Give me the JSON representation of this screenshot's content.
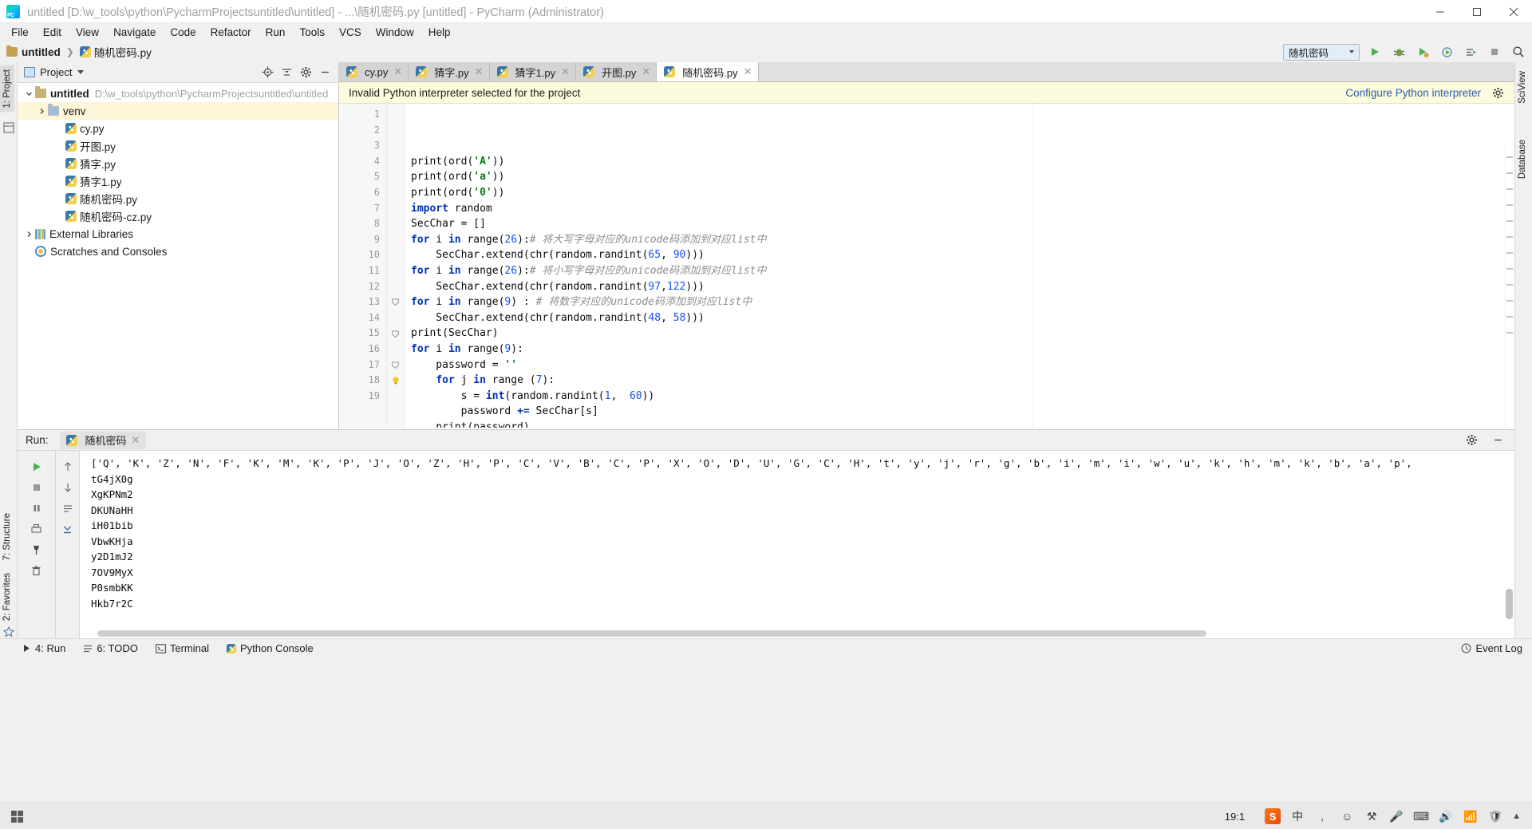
{
  "window": {
    "title": "untitled [D:\\w_tools\\python\\PycharmProjectsuntitled\\untitled] - ...\\随机密码.py [untitled] - PyCharm (Administrator)",
    "minimize": "–",
    "maximize": "□",
    "close": "✕"
  },
  "menubar": {
    "items": [
      {
        "label": "File"
      },
      {
        "label": "Edit"
      },
      {
        "label": "View"
      },
      {
        "label": "Navigate"
      },
      {
        "label": "Code"
      },
      {
        "label": "Refactor"
      },
      {
        "label": "Run"
      },
      {
        "label": "Tools"
      },
      {
        "label": "VCS"
      },
      {
        "label": "Window"
      },
      {
        "label": "Help"
      }
    ]
  },
  "navbar": {
    "project_crumb": "untitled",
    "separator": "❯",
    "file_crumb": "随机密码.py",
    "run_config": "随机密码"
  },
  "project_panel": {
    "title": "Project",
    "tree": [
      {
        "label": "untitled",
        "path": "D:\\w_tools\\python\\PycharmProjectsuntitled\\untitled",
        "type": "project-root",
        "indent": 0,
        "expanded": true,
        "highlighted": false
      },
      {
        "label": "venv",
        "path": "",
        "type": "folder",
        "indent": 1,
        "expanded": false,
        "highlighted": true
      },
      {
        "label": "cy.py",
        "path": "",
        "type": "python-file",
        "indent": 2,
        "expanded": null,
        "highlighted": false
      },
      {
        "label": "开图.py",
        "path": "",
        "type": "python-file",
        "indent": 2,
        "expanded": null,
        "highlighted": false
      },
      {
        "label": "猜字.py",
        "path": "",
        "type": "python-file",
        "indent": 2,
        "expanded": null,
        "highlighted": false
      },
      {
        "label": "猜字1.py",
        "path": "",
        "type": "python-file",
        "indent": 2,
        "expanded": null,
        "highlighted": false
      },
      {
        "label": "随机密码.py",
        "path": "",
        "type": "python-file",
        "indent": 2,
        "expanded": null,
        "highlighted": false
      },
      {
        "label": "随机密码-cz.py",
        "path": "",
        "type": "python-file",
        "indent": 2,
        "expanded": null,
        "highlighted": false
      },
      {
        "label": "External Libraries",
        "path": "",
        "type": "library",
        "indent": 0,
        "expanded": false,
        "highlighted": false
      },
      {
        "label": "Scratches and Consoles",
        "path": "",
        "type": "scratch",
        "indent": 0,
        "expanded": null,
        "highlighted": false
      }
    ]
  },
  "editor": {
    "tabs": [
      {
        "label": "cy.py",
        "active": false
      },
      {
        "label": "猜字.py",
        "active": false
      },
      {
        "label": "猜字1.py",
        "active": false
      },
      {
        "label": "开图.py",
        "active": false
      },
      {
        "label": "随机密码.py",
        "active": true
      }
    ],
    "close_glyph": "✕",
    "notice": {
      "message": "Invalid Python interpreter selected for the project",
      "action": "Configure Python interpreter"
    },
    "lines": [
      {
        "n": 1,
        "tokens": [
          {
            "t": "print(ord(",
            "c": "bi"
          },
          {
            "t": "'A'",
            "c": "str"
          },
          {
            "t": "))",
            "c": "bi"
          }
        ]
      },
      {
        "n": 2,
        "tokens": [
          {
            "t": "print(ord(",
            "c": "bi"
          },
          {
            "t": "'a'",
            "c": "str"
          },
          {
            "t": "))",
            "c": "bi"
          }
        ]
      },
      {
        "n": 3,
        "tokens": [
          {
            "t": "print(ord(",
            "c": "bi"
          },
          {
            "t": "'0'",
            "c": "str"
          },
          {
            "t": "))",
            "c": "bi"
          }
        ]
      },
      {
        "n": 4,
        "tokens": [
          {
            "t": "import",
            "c": "kw"
          },
          {
            "t": " random",
            "c": "bi"
          }
        ]
      },
      {
        "n": 5,
        "tokens": [
          {
            "t": "SecChar = []",
            "c": "bi"
          }
        ]
      },
      {
        "n": 6,
        "tokens": [
          {
            "t": "for",
            "c": "kw"
          },
          {
            "t": " i ",
            "c": "bi"
          },
          {
            "t": "in",
            "c": "kw"
          },
          {
            "t": " range(",
            "c": "bi"
          },
          {
            "t": "26",
            "c": "num"
          },
          {
            "t": "):",
            "c": "bi"
          },
          {
            "t": "# 将大写字母对应的unicode码添加到对应list中",
            "c": "cmt"
          }
        ]
      },
      {
        "n": 7,
        "tokens": [
          {
            "t": "    SecChar.extend(chr(random.randint(",
            "c": "bi"
          },
          {
            "t": "65",
            "c": "num"
          },
          {
            "t": ", ",
            "c": "bi"
          },
          {
            "t": "90",
            "c": "num"
          },
          {
            "t": ")))",
            "c": "bi"
          }
        ]
      },
      {
        "n": 8,
        "tokens": [
          {
            "t": "for",
            "c": "kw"
          },
          {
            "t": " i ",
            "c": "bi"
          },
          {
            "t": "in",
            "c": "kw"
          },
          {
            "t": " range(",
            "c": "bi"
          },
          {
            "t": "26",
            "c": "num"
          },
          {
            "t": "):",
            "c": "bi"
          },
          {
            "t": "# 将小写字母对应的unicode码添加到对应list中",
            "c": "cmt"
          }
        ]
      },
      {
        "n": 9,
        "tokens": [
          {
            "t": "    SecChar.extend(chr(random.randint(",
            "c": "bi"
          },
          {
            "t": "97",
            "c": "num"
          },
          {
            "t": ",",
            "c": "bi"
          },
          {
            "t": "122",
            "c": "num"
          },
          {
            "t": ")))",
            "c": "bi"
          }
        ]
      },
      {
        "n": 10,
        "tokens": [
          {
            "t": "for",
            "c": "kw"
          },
          {
            "t": " i ",
            "c": "bi"
          },
          {
            "t": "in",
            "c": "kw"
          },
          {
            "t": " range(",
            "c": "bi"
          },
          {
            "t": "9",
            "c": "num"
          },
          {
            "t": ") : ",
            "c": "bi"
          },
          {
            "t": "# 将数字对应的unicode码添加到对应list中",
            "c": "cmt"
          }
        ]
      },
      {
        "n": 11,
        "tokens": [
          {
            "t": "    SecChar.extend(chr(random.randint(",
            "c": "bi"
          },
          {
            "t": "48",
            "c": "num"
          },
          {
            "t": ", ",
            "c": "bi"
          },
          {
            "t": "58",
            "c": "num"
          },
          {
            "t": ")))",
            "c": "bi"
          }
        ]
      },
      {
        "n": 12,
        "tokens": [
          {
            "t": "print(SecChar)",
            "c": "bi"
          }
        ]
      },
      {
        "n": 13,
        "tokens": [
          {
            "t": "for",
            "c": "kw"
          },
          {
            "t": " i ",
            "c": "bi"
          },
          {
            "t": "in",
            "c": "kw"
          },
          {
            "t": " range(",
            "c": "bi"
          },
          {
            "t": "9",
            "c": "num"
          },
          {
            "t": "):",
            "c": "bi"
          }
        ],
        "fold": true
      },
      {
        "n": 14,
        "tokens": [
          {
            "t": "    password = ",
            "c": "bi"
          },
          {
            "t": "''",
            "c": "str"
          }
        ]
      },
      {
        "n": 15,
        "tokens": [
          {
            "t": "    ",
            "c": "bi"
          },
          {
            "t": "for",
            "c": "kw"
          },
          {
            "t": " j ",
            "c": "bi"
          },
          {
            "t": "in",
            "c": "kw"
          },
          {
            "t": " range",
            "c": "bi"
          },
          {
            "t": " (",
            "c": "bi"
          },
          {
            "t": "7",
            "c": "num"
          },
          {
            "t": "):",
            "c": "bi"
          }
        ],
        "fold": true
      },
      {
        "n": 16,
        "tokens": [
          {
            "t": "        s = ",
            "c": "bi"
          },
          {
            "t": "int",
            "c": "kw"
          },
          {
            "t": "(random.randint(",
            "c": "bi"
          },
          {
            "t": "1",
            "c": "num"
          },
          {
            "t": ",  ",
            "c": "bi"
          },
          {
            "t": "60",
            "c": "num"
          },
          {
            "t": "))",
            "c": "bi"
          }
        ]
      },
      {
        "n": 17,
        "tokens": [
          {
            "t": "        password ",
            "c": "bi"
          },
          {
            "t": "+=",
            "c": "kw"
          },
          {
            "t": " SecChar[s]",
            "c": "bi"
          }
        ],
        "fold": true
      },
      {
        "n": 18,
        "tokens": [
          {
            "t": "    print(password)",
            "c": "bi"
          }
        ],
        "fold": true,
        "bulb": true
      },
      {
        "n": 19,
        "tokens": [
          {
            "t": "",
            "c": "bi"
          }
        ],
        "current": true
      }
    ]
  },
  "run_panel": {
    "label": "Run:",
    "tab": "随机密码",
    "close_glyph": "✕",
    "output": [
      "['Q', 'K', 'Z', 'N', 'F', 'K', 'M', 'K', 'P', 'J', 'O', 'Z', 'H', 'P', 'C', 'V', 'B', 'C', 'P', 'X', 'O', 'D', 'U', 'G', 'C', 'H', 't', 'y', 'j', 'r', 'g', 'b', 'i', 'm', 'i', 'w', 'u', 'k', 'h', 'm', 'k', 'b', 'a', 'p',",
      "tG4jX0g",
      "XgKPNm2",
      "DKUNaHH",
      "iH01bib",
      "VbwKHja",
      "y2D1mJ2",
      "7OV9MyX",
      "P0smbKK",
      "Hkb7r2C"
    ]
  },
  "statusbar": {
    "items": [
      {
        "label": "4: Run",
        "icon": "play-icon"
      },
      {
        "label": "6: TODO",
        "icon": "todo-icon"
      },
      {
        "label": "Terminal",
        "icon": "terminal-icon"
      },
      {
        "label": "Python Console",
        "icon": "python-icon"
      }
    ],
    "event_log": "Event Log",
    "caret_position": "19:1"
  },
  "left_rail": {
    "tabs": [
      {
        "label": "1: Project",
        "selected": true
      },
      {
        "label": "7: Structure",
        "selected": false
      },
      {
        "label": "2: Favorites",
        "selected": false
      }
    ]
  },
  "right_rail": {
    "tabs": [
      {
        "label": "SciView",
        "selected": false
      },
      {
        "label": "Database",
        "selected": false
      }
    ]
  },
  "colors": {
    "accent_blue": "#2a5db0",
    "notice_bg": "#fcfbdd",
    "highlight_row": "#fdf6d8",
    "keyword": "#0033b3",
    "string": "#067d17",
    "number": "#1750eb",
    "comment": "#8c8c8c"
  }
}
